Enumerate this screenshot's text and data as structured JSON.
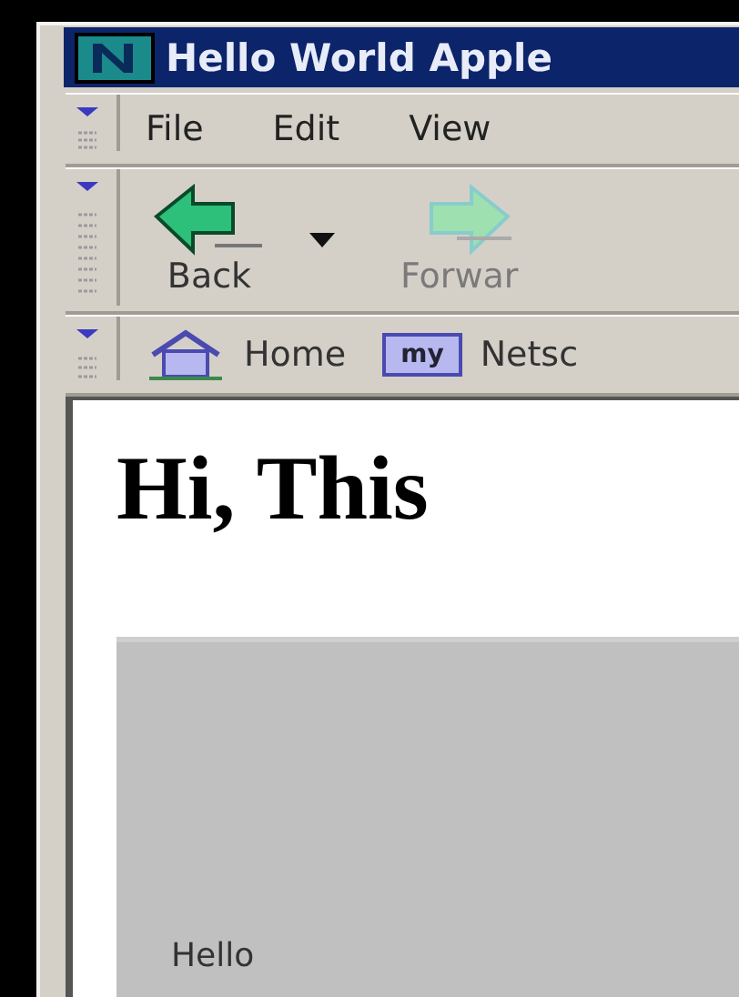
{
  "window": {
    "title": "Hello World Apple"
  },
  "menu": [
    {
      "label": "File"
    },
    {
      "label": "Edit"
    },
    {
      "label": "View"
    }
  ],
  "navigation_toolbar": [
    {
      "kind": "back",
      "label": "Back",
      "disabled": false
    },
    {
      "kind": "caret"
    },
    {
      "kind": "forward",
      "label": "Forwar",
      "disabled": true
    }
  ],
  "personal_toolbar": [
    {
      "kind": "home",
      "label": "Home"
    },
    {
      "kind": "my",
      "badge": "my",
      "label": "Netsc"
    }
  ],
  "page": {
    "heading": "Hi, This",
    "applet": {
      "text": "Hello"
    }
  }
}
